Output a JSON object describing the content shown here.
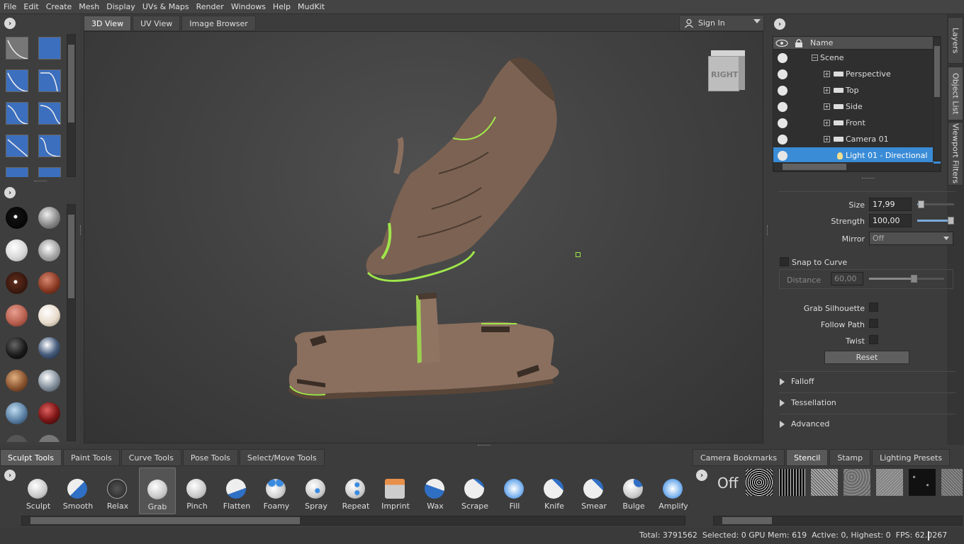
{
  "menu": [
    "File",
    "Edit",
    "Create",
    "Mesh",
    "Display",
    "UVs & Maps",
    "Render",
    "Windows",
    "Help",
    "MudKit"
  ],
  "view_tabs": [
    "3D View",
    "UV View",
    "Image Browser"
  ],
  "sign_in": "Sign In",
  "view_cube_label": "RIGHT",
  "side_tabs": [
    "Layers",
    "Object List",
    "Viewport Filters"
  ],
  "tree": {
    "header": "Name",
    "rows": [
      {
        "label": "Scene"
      },
      {
        "label": "Perspective"
      },
      {
        "label": "Top"
      },
      {
        "label": "Side"
      },
      {
        "label": "Front"
      },
      {
        "label": "Camera 01"
      },
      {
        "label": "Light 01 - Directional"
      }
    ]
  },
  "props": {
    "size_label": "Size",
    "size_value": "17,99",
    "size_level": 0.12,
    "strength_label": "Strength",
    "strength_value": "100,00",
    "strength_level": 1.0,
    "mirror_label": "Mirror",
    "mirror_value": "Off",
    "snap_label": "Snap to Curve",
    "distance_label": "Distance",
    "distance_value": "60,00",
    "distance_level": 0.6,
    "grab_silhouette": "Grab Silhouette",
    "follow_path": "Follow Path",
    "twist": "Twist",
    "reset": "Reset",
    "sections": [
      "Falloff",
      "Tessellation",
      "Advanced"
    ]
  },
  "bottom_tabs": [
    "Sculpt Tools",
    "Paint Tools",
    "Curve Tools",
    "Pose Tools",
    "Select/Move Tools"
  ],
  "tools": [
    "Sculpt",
    "Smooth",
    "Relax",
    "Grab",
    "Pinch",
    "Flatten",
    "Foamy",
    "Spray",
    "Repeat",
    "Imprint",
    "Wax",
    "Scrape",
    "Fill",
    "Knife",
    "Smear",
    "Bulge",
    "Amplify"
  ],
  "active_tool": "Grab",
  "right_bottom_tabs": [
    "Camera Bookmarks",
    "Stencil",
    "Stamp",
    "Lighting Presets"
  ],
  "stencil_off": "Off",
  "status": "Total: 3791562  Selected: 0 GPU Mem: 619  Active: 0, Highest: 0  FPS: 62.0267"
}
